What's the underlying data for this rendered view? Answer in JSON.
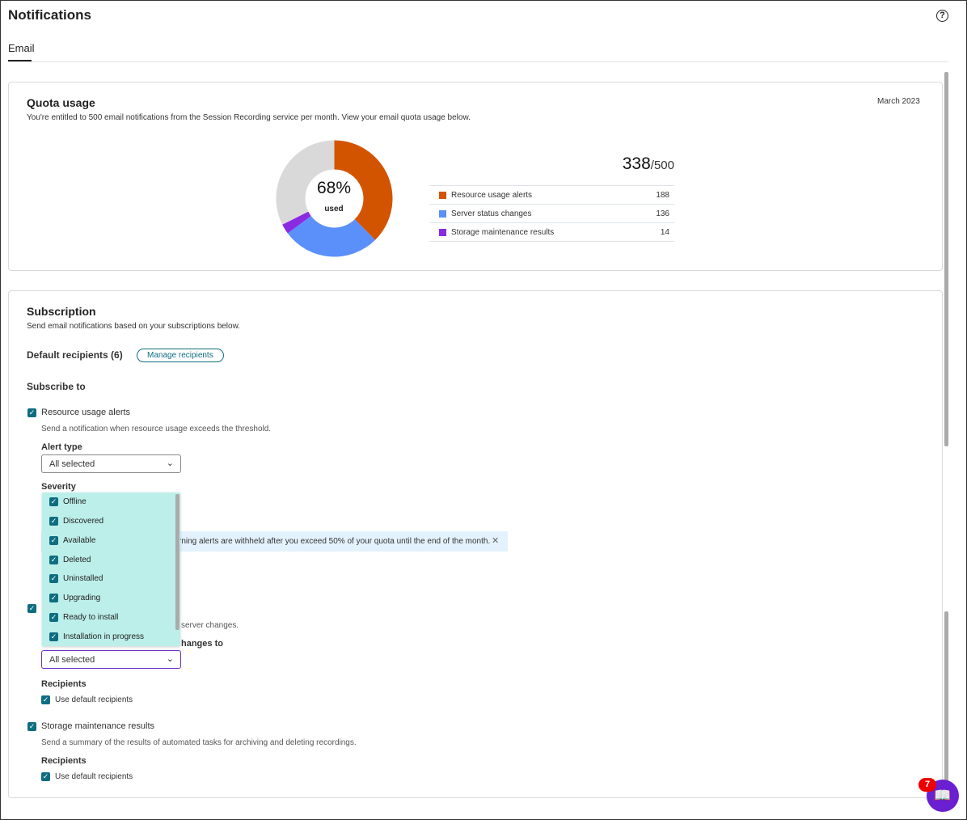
{
  "header": {
    "title": "Notifications",
    "help_icon": "?"
  },
  "tabs": [
    {
      "label": "Email",
      "active": true
    }
  ],
  "quota": {
    "title": "Quota usage",
    "description": "You're entitled to 500 email notifications from the Session Recording service per month. View your email quota usage below.",
    "period": "March 2023",
    "percent_label": "68%",
    "used_label": "used",
    "used": "338",
    "total": "/500",
    "items": [
      {
        "label": "Resource usage alerts",
        "value": "188",
        "color": "#d35400"
      },
      {
        "label": "Server status changes",
        "value": "136",
        "color": "#5b8ff9"
      },
      {
        "label": "Storage maintenance results",
        "value": "14",
        "color": "#8a2be2"
      }
    ],
    "remaining_color": "#d9d9d9"
  },
  "chart_data": {
    "type": "pie",
    "categories": [
      "Resource usage alerts",
      "Server status changes",
      "Storage maintenance results",
      "Remaining"
    ],
    "values": [
      188,
      136,
      14,
      162
    ],
    "title": "Quota usage",
    "center_label": "68% used"
  },
  "subscription": {
    "title": "Subscription",
    "description": "Send email notifications based on your subscriptions below.",
    "default_recipients": "Default recipients (6)",
    "manage_button": "Manage recipients",
    "subscribe_to": "Subscribe to",
    "resource": {
      "label": "Resource usage alerts",
      "description": "Send a notification when resource usage exceeds the threshold.",
      "alert_type_label": "Alert type",
      "alert_type_value": "All selected",
      "severity_label": "Severity"
    },
    "info_banner_fragment": "rning alerts are withheld after you exceed 50% of your quota until the end of the month.",
    "server_desc_fragment": "server changes.",
    "server_field_fragment": "hanges to",
    "server_select_value": "All selected",
    "server_recipients_label": "Recipients",
    "server_use_default": "Use default recipients",
    "storage": {
      "label": "Storage maintenance results",
      "description": "Send a summary of the results of automated tasks for archiving and deleting recordings.",
      "recipients_label": "Recipients",
      "use_default": "Use default recipients"
    }
  },
  "dropdown_options": [
    "Offline",
    "Discovered",
    "Available",
    "Deleted",
    "Uninstalled",
    "Upgrading",
    "Ready to install",
    "Installation in progress"
  ],
  "fab": {
    "badge": "7"
  }
}
